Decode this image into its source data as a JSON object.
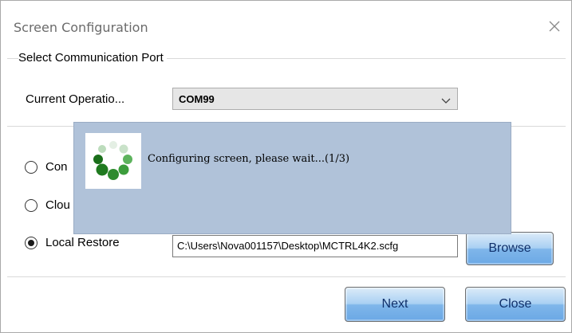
{
  "window": {
    "title": "Screen Configuration"
  },
  "port_section": {
    "title": "Select Communication Port",
    "current_label": "Current Operatio...",
    "selected_port": "COM99"
  },
  "options": {
    "connect_label": "Con",
    "cloud_label": "Clou",
    "local_restore_label": "Local Restore",
    "selected": "local_restore",
    "file_path": "C:\\Users\\Nova001157\\Desktop\\MCTRL4K2.scfg",
    "browse_label": "Browse"
  },
  "footer": {
    "next_label": "Next",
    "close_label": "Close"
  },
  "progress_overlay": {
    "message": "Configuring screen, please wait...(1/3)",
    "icon": "loading-spinner-icon",
    "colors": {
      "background": "#b0c2d9",
      "spinner_green": "#2e8b2e"
    }
  }
}
